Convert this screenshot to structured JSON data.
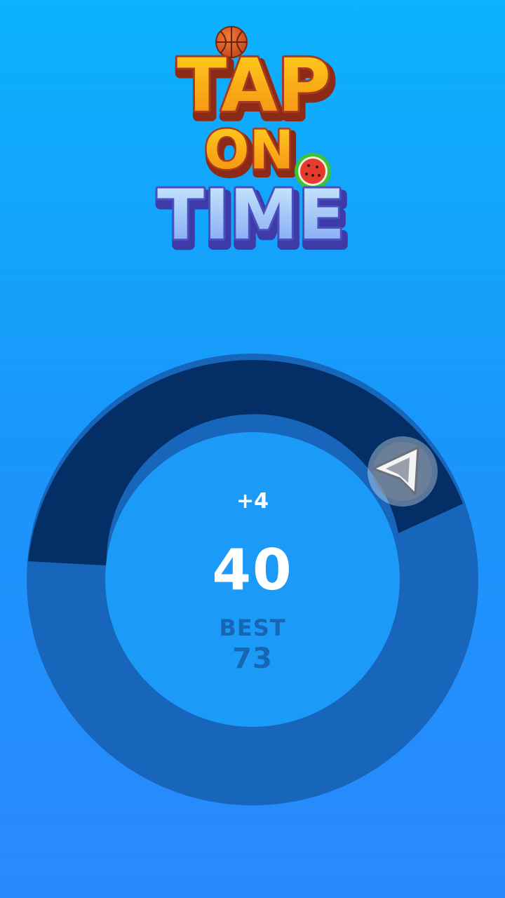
{
  "title": {
    "word1": "TAP",
    "word2": "ON",
    "word3": "TIME"
  },
  "score": {
    "delta": "+4",
    "current": "40",
    "best_label": "BEST",
    "best_value": "73"
  },
  "colors": {
    "ring_base": "#1866bb",
    "ring_fill": "#032f66",
    "inner_circle": "#1c9af8",
    "best_text": "#1865b4"
  },
  "icons": {
    "ball": "basketball-icon",
    "fruit": "watermelon-slice-icon",
    "tap_button": "arrow-tap-icon"
  }
}
